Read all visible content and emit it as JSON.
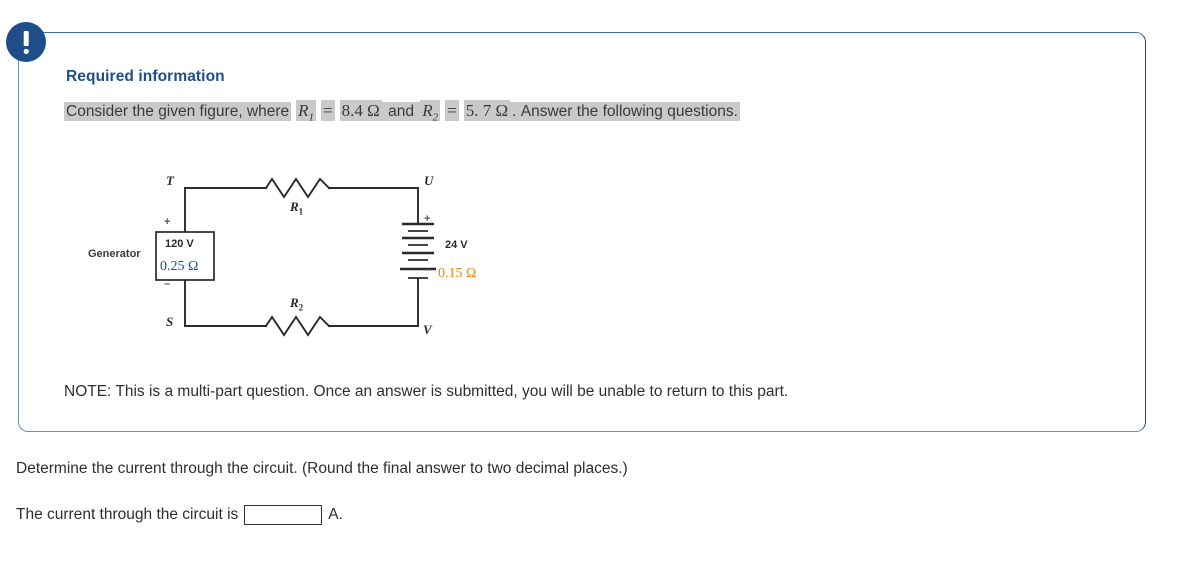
{
  "alert": {
    "icon": "exclamation-circle-icon",
    "color": "#1d4e89"
  },
  "card": {
    "title": "Required information",
    "statement": {
      "lead": "Consider the given figure, where",
      "r1_symbol": "R",
      "r1_sub": "1",
      "eq1": "=",
      "r1_value": "8.4 Ω",
      "conj": "and",
      "r2_symbol": "R",
      "r2_sub": "2",
      "eq2": "=",
      "r2_value": "5. 7 Ω",
      "tail": ". Answer the following questions."
    },
    "note": "NOTE: This is a multi-part question. Once an answer is submitted, you will be unable to return to this part."
  },
  "figure": {
    "name": "series-circuit-diagram",
    "nodes": {
      "top_left": "T",
      "top_right": "U",
      "bottom_left": "S",
      "bottom_right": "V"
    },
    "generator": {
      "label": "Generator",
      "voltage": "120 V",
      "resistance": "0.25 Ω",
      "terminal_plus": "+",
      "terminal_minus": "–",
      "resistance_color": "#1d4e89",
      "omega_color": "#e8820c"
    },
    "battery": {
      "voltage": "24 V",
      "resistance": "0.15 Ω",
      "terminal_plus": "+",
      "terminal_minus": "–",
      "resistance_color": "#e8820c"
    },
    "resistors": [
      {
        "label": "R",
        "sub": "1",
        "position": "top"
      },
      {
        "label": "R",
        "sub": "2",
        "position": "bottom"
      }
    ]
  },
  "question": {
    "prompt": "Determine the current through the circuit. (Round the final answer to two decimal places.)",
    "answer_prefix": "The current through the circuit is",
    "answer_value": "",
    "answer_placeholder": "",
    "answer_unit": "A."
  }
}
